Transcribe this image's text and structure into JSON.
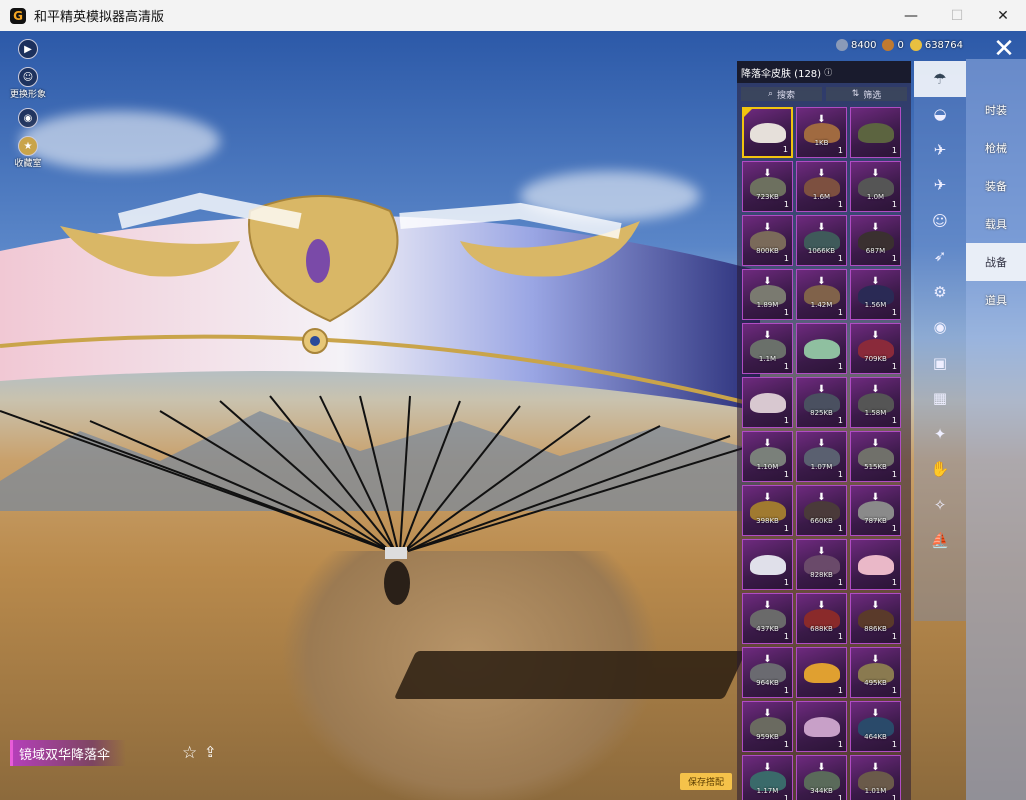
{
  "window": {
    "title": "和平精英模拟器高清版",
    "app_icon_letter": "G"
  },
  "left_menu": {
    "items": [
      {
        "icon": "play-icon",
        "label": ""
      },
      {
        "icon": "person-icon",
        "label": "更换形象"
      },
      {
        "icon": "eye-icon",
        "label": ""
      },
      {
        "icon": "collection-icon",
        "label": "收藏室"
      }
    ]
  },
  "currency": {
    "silver": "8400",
    "bronze": "0",
    "gold": "638764"
  },
  "panel": {
    "title": "降落伞皮肤 (128)",
    "search_label": "搜索",
    "filter_label": "筛选"
  },
  "right_nav": {
    "items": [
      {
        "label": "时装",
        "active": false
      },
      {
        "label": "枪械",
        "active": false
      },
      {
        "label": "装备",
        "active": false
      },
      {
        "label": "载具",
        "active": false
      },
      {
        "label": "战备",
        "active": true
      },
      {
        "label": "道具",
        "active": false
      }
    ]
  },
  "category_icons": [
    "parachute-icon",
    "ufo-icon",
    "drone-icon",
    "plane-icon",
    "emote-icon",
    "glider-icon",
    "robot-icon",
    "radio-icon",
    "box-icon",
    "photo-icon",
    "grenade-icon",
    "hand-icon",
    "wand-icon",
    "ship-icon"
  ],
  "grid_items": [
    {
      "size": "",
      "count": "1",
      "download": false,
      "selected": true,
      "color": "#e6e0da"
    },
    {
      "size": "1KB",
      "count": "1",
      "download": true,
      "color": "#a06a40"
    },
    {
      "size": "",
      "count": "1",
      "download": false,
      "color": "#5c6440"
    },
    {
      "size": "723KB",
      "count": "1",
      "download": true,
      "color": "#6d705f"
    },
    {
      "size": "1.6M",
      "count": "1",
      "download": true,
      "color": "#7d5040"
    },
    {
      "size": "1.0M",
      "count": "1",
      "download": true,
      "color": "#555"
    },
    {
      "size": "800KB",
      "count": "1",
      "download": true,
      "color": "#7a6a5a"
    },
    {
      "size": "1066KB",
      "count": "1",
      "download": true,
      "color": "#3f5a5a"
    },
    {
      "size": "687M",
      "count": "1",
      "download": true,
      "color": "#3a3030"
    },
    {
      "size": "1.89M",
      "count": "1",
      "download": true,
      "color": "#7a7a70"
    },
    {
      "size": "1.42M",
      "count": "1",
      "download": true,
      "color": "#80624a"
    },
    {
      "size": "1.56M",
      "count": "1",
      "download": true,
      "color": "#2a2a55"
    },
    {
      "size": "1.1M",
      "count": "1",
      "download": true,
      "color": "#6a706a"
    },
    {
      "size": "",
      "count": "1",
      "download": false,
      "color": "#8fc0a0"
    },
    {
      "size": "709KB",
      "count": "1",
      "download": true,
      "color": "#8a2a3a"
    },
    {
      "size": "",
      "count": "1",
      "download": false,
      "color": "#d8c8d0"
    },
    {
      "size": "825KB",
      "count": "1",
      "download": true,
      "color": "#4a5060"
    },
    {
      "size": "1.58M",
      "count": "1",
      "download": true,
      "color": "#555"
    },
    {
      "size": "1.10M",
      "count": "1",
      "download": true,
      "color": "#7a807a"
    },
    {
      "size": "1.07M",
      "count": "1",
      "download": true,
      "color": "#5a6070"
    },
    {
      "size": "515KB",
      "count": "1",
      "download": true,
      "color": "#70706a"
    },
    {
      "size": "398KB",
      "count": "1",
      "download": true,
      "color": "#a07a30"
    },
    {
      "size": "660KB",
      "count": "1",
      "download": true,
      "color": "#4a3a3a"
    },
    {
      "size": "787KB",
      "count": "1",
      "download": true,
      "color": "#8a8a8a"
    },
    {
      "size": "",
      "count": "1",
      "download": false,
      "color": "#e0e0ea"
    },
    {
      "size": "828KB",
      "count": "1",
      "download": true,
      "color": "#6a4a6a"
    },
    {
      "size": "",
      "count": "1",
      "download": false,
      "color": "#eab8c8"
    },
    {
      "size": "437KB",
      "count": "1",
      "download": true,
      "color": "#6a6a6a"
    },
    {
      "size": "688KB",
      "count": "1",
      "download": true,
      "color": "#8a2a2a"
    },
    {
      "size": "886KB",
      "count": "1",
      "download": true,
      "color": "#5a3a2a"
    },
    {
      "size": "964KB",
      "count": "1",
      "download": true,
      "color": "#6a6a70"
    },
    {
      "size": "",
      "count": "1",
      "download": false,
      "color": "#e0a030"
    },
    {
      "size": "495KB",
      "count": "1",
      "download": true,
      "color": "#8a7a50"
    },
    {
      "size": "959KB",
      "count": "1",
      "download": true,
      "color": "#6a6a60"
    },
    {
      "size": "",
      "count": "1",
      "download": false,
      "color": "#c8a0c8"
    },
    {
      "size": "464KB",
      "count": "1",
      "download": true,
      "color": "#2a4a6a"
    },
    {
      "size": "1.17M",
      "count": "1",
      "download": true,
      "color": "#3a6a6a"
    },
    {
      "size": "344KB",
      "count": "1",
      "download": true,
      "color": "#5a6a5a"
    },
    {
      "size": "1.01M",
      "count": "1",
      "download": true,
      "color": "#6a5a4a"
    }
  ],
  "item_name": "镜域双华降落伞",
  "save_button": "保存搭配"
}
